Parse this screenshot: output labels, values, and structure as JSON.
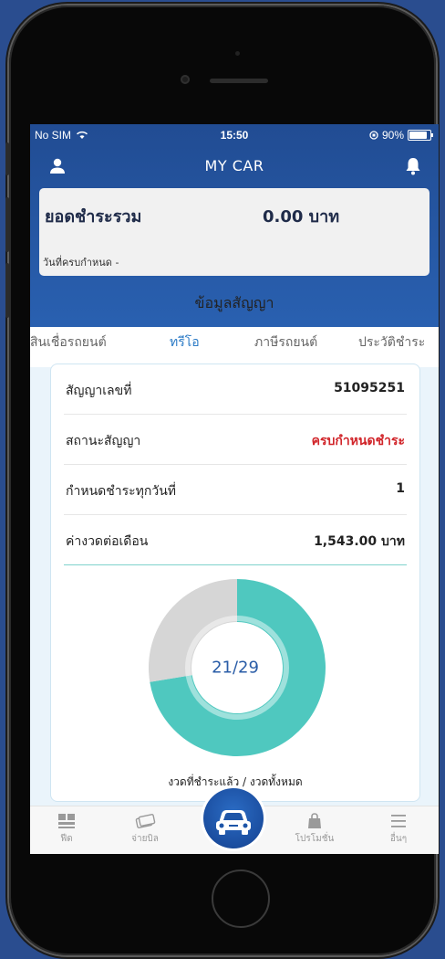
{
  "status_bar": {
    "carrier": "No SIM",
    "time": "15:50",
    "battery": "90%"
  },
  "header": {
    "title": "MY CAR",
    "user_icon": "user-icon",
    "bell_icon": "bell-icon"
  },
  "summary": {
    "label": "ยอดชำระรวม",
    "amount": "0.00 บาท",
    "due_label": "วันที่ครบกำหนด -"
  },
  "section_title": "ข้อมูลสัญญา",
  "tabs": [
    {
      "label": "สินเชื่อรถยนต์"
    },
    {
      "label": "ทรีโอ"
    },
    {
      "label": "ภาษีรถยนต์"
    },
    {
      "label": "ประวัติชำระ"
    }
  ],
  "contract": {
    "rows": [
      {
        "key": "สัญญาเลขที่",
        "value": "51095251"
      },
      {
        "key": "สถานะสัญญา",
        "value": "ครบกำหนดชำระ"
      },
      {
        "key": "กำหนดชำระทุกวันที่",
        "value": "1"
      },
      {
        "key": "ค่างวดต่อเดือน",
        "value": "1,543.00 บาท"
      }
    ]
  },
  "chart_data": {
    "type": "pie",
    "paid": 21,
    "total": 29,
    "center_label": "21/29",
    "caption": "งวดที่ชำระแล้ว / งวดทั้งหมด",
    "colors": {
      "paid": "#4fc8bf",
      "remaining": "#d6d6d6"
    }
  },
  "bottom_nav": [
    {
      "label": "ฟีด",
      "icon": "feed-icon"
    },
    {
      "label": "จ่ายบิล",
      "icon": "bill-icon"
    },
    {
      "label": "",
      "icon": "car-icon"
    },
    {
      "label": "โปรโมชั่น",
      "icon": "bag-icon"
    },
    {
      "label": "อื่นๆ",
      "icon": "menu-icon"
    }
  ],
  "colors": {
    "primary_blue": "#2a62b3",
    "accent_blue": "#2c7bc6",
    "teal": "#4fc8bf",
    "alert_red": "#d1252a"
  }
}
